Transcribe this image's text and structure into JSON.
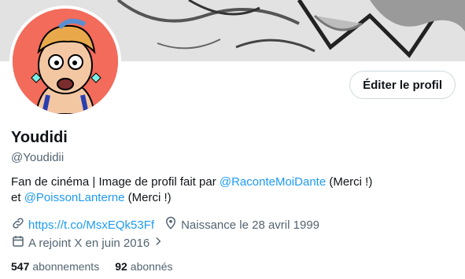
{
  "profile": {
    "edit_button_label": "Éditer le profil",
    "display_name": "Youdidi",
    "handle": "@Youdidii",
    "bio": {
      "line1_text": "Fan de cinéma | Image de profil fait par ",
      "line1_mention": "@RaconteMoiDante",
      "line1_suffix": " (Merci !)",
      "line2_prefix": "et ",
      "line2_mention": "@PoissonLanterne",
      "line2_suffix": " (Merci !)"
    },
    "website": "https://t.co/MsxEQk53Ff",
    "birth": "Naissance le 28 avril 1999",
    "joined": "A rejoint X en juin 2016",
    "following_count": "547",
    "following_label": "abonnements",
    "followers_count": "92",
    "followers_label": "abonnés"
  },
  "colors": {
    "accent": "#1d9bf0",
    "secondary_text": "#536471",
    "avatar_bg": "#f26b5b"
  },
  "icons": [
    "link-icon",
    "location-pin-icon",
    "calendar-icon",
    "chevron-right-icon"
  ]
}
